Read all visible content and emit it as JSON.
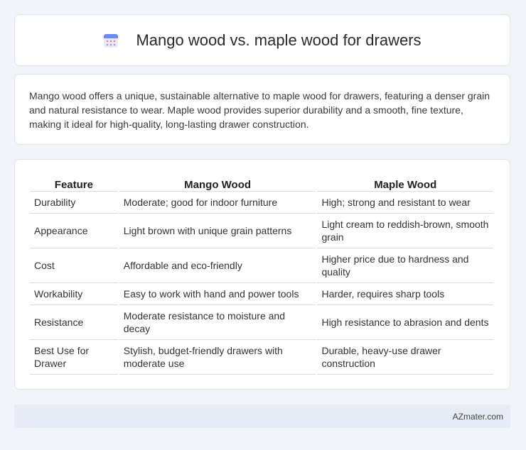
{
  "header": {
    "title": "Mango wood vs. maple wood for drawers",
    "icon": "calendar-icon"
  },
  "intro": {
    "text": "Mango wood offers a unique, sustainable alternative to maple wood for drawers, featuring a denser grain and natural resistance to wear. Maple wood provides superior durability and a smooth, fine texture, making it ideal for high-quality, long-lasting drawer construction."
  },
  "table": {
    "headers": [
      "Feature",
      "Mango Wood",
      "Maple Wood"
    ],
    "rows": [
      [
        "Durability",
        "Moderate; good for indoor furniture",
        "High; strong and resistant to wear"
      ],
      [
        "Appearance",
        "Light brown with unique grain patterns",
        "Light cream to reddish-brown, smooth grain"
      ],
      [
        "Cost",
        "Affordable and eco-friendly",
        "Higher price due to hardness and quality"
      ],
      [
        "Workability",
        "Easy to work with hand and power tools",
        "Harder, requires sharp tools"
      ],
      [
        "Resistance",
        "Moderate resistance to moisture and decay",
        "High resistance to abrasion and dents"
      ],
      [
        "Best Use for Drawer",
        "Stylish, budget-friendly drawers with moderate use",
        "Durable, heavy-use drawer construction"
      ]
    ]
  },
  "footer": {
    "brand": "AZmater.com"
  }
}
